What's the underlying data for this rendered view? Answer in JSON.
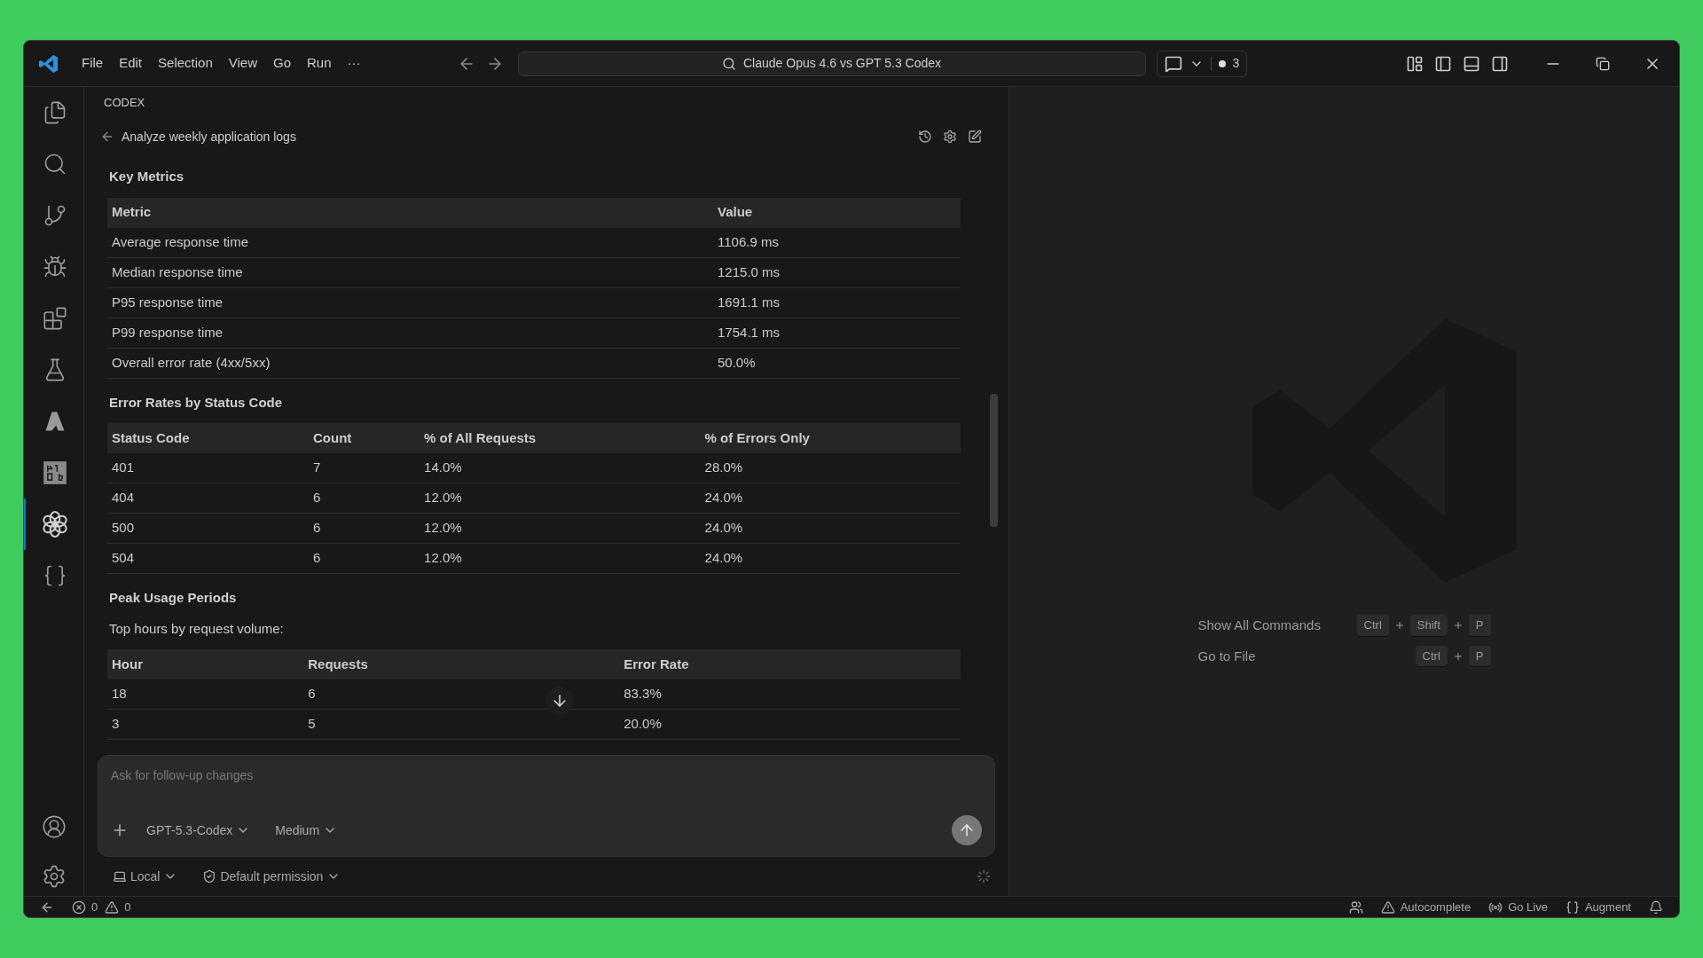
{
  "menu": [
    "File",
    "Edit",
    "Selection",
    "View",
    "Go",
    "Run",
    "···"
  ],
  "command_center": {
    "text": "Claude Opus 4.6 vs GPT 5.3 Codex"
  },
  "chat_badge": {
    "count": "3"
  },
  "activity_bar": [
    {
      "kind": "explorer",
      "selected": false
    },
    {
      "kind": "search",
      "selected": false
    },
    {
      "kind": "source-control",
      "selected": false
    },
    {
      "kind": "debug",
      "selected": false
    },
    {
      "kind": "extensions",
      "selected": false
    },
    {
      "kind": "testing",
      "selected": false
    },
    {
      "kind": "azure",
      "selected": false
    },
    {
      "kind": "kilo",
      "selected": false
    },
    {
      "kind": "codex",
      "selected": true
    },
    {
      "kind": "bot",
      "selected": false
    }
  ],
  "activity_bottom": [
    {
      "kind": "account"
    },
    {
      "kind": "settings"
    }
  ],
  "panel": {
    "title": "CODEX",
    "thread_title": "Analyze weekly application logs"
  },
  "sections": [
    {
      "heading": "Key Metrics",
      "columns": [
        "Metric",
        "Value"
      ],
      "rows": [
        [
          "Average response time",
          "1106.9 ms"
        ],
        [
          "Median response time",
          "1215.0 ms"
        ],
        [
          "P95 response time",
          "1691.1 ms"
        ],
        [
          "P99 response time",
          "1754.1 ms"
        ],
        [
          "Overall error rate (4xx/5xx)",
          "50.0%"
        ]
      ]
    },
    {
      "heading": "Error Rates by Status Code",
      "columns": [
        "Status Code",
        "Count",
        "% of All Requests",
        "% of Errors Only"
      ],
      "rows": [
        [
          "401",
          "7",
          "14.0%",
          "28.0%"
        ],
        [
          "404",
          "6",
          "12.0%",
          "24.0%"
        ],
        [
          "500",
          "6",
          "12.0%",
          "24.0%"
        ],
        [
          "504",
          "6",
          "12.0%",
          "24.0%"
        ]
      ]
    },
    {
      "heading": "Peak Usage Periods",
      "intro": "Top hours by request volume:",
      "columns": [
        "Hour",
        "Requests",
        "Error Rate"
      ],
      "rows": [
        [
          "18",
          "6",
          "83.3%"
        ],
        [
          "3",
          "5",
          "20.0%"
        ]
      ]
    }
  ],
  "composer": {
    "placeholder": "Ask for follow-up changes",
    "model": "GPT-5.3-Codex",
    "effort": "Medium",
    "location": "Local",
    "permission": "Default permission"
  },
  "welcome": [
    {
      "label": "Show All Commands",
      "keys": [
        "Ctrl",
        "Shift",
        "P"
      ]
    },
    {
      "label": "Go to File",
      "keys": [
        "Ctrl",
        "P"
      ]
    }
  ],
  "status_bar": {
    "left": [
      {
        "kind": "errors",
        "text": "0"
      },
      {
        "kind": "warnings",
        "text": "0"
      }
    ],
    "right": [
      {
        "kind": "copilot"
      },
      {
        "kind": "autocomplete",
        "text": "Autocomplete"
      },
      {
        "kind": "live",
        "text": "Go Live"
      },
      {
        "kind": "augment",
        "text": "Augment"
      },
      {
        "kind": "bell"
      }
    ]
  }
}
